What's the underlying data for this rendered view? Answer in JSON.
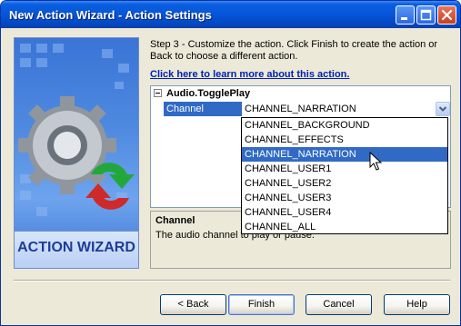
{
  "window": {
    "title": "New Action Wizard - Action Settings",
    "titlebar_color": "#0655d8",
    "controls": [
      "minimize-icon",
      "maximize-icon",
      "close-icon"
    ]
  },
  "side_panel": {
    "banner_text": "ACTION WIZARD",
    "icon": "gear-with-arrows-icon"
  },
  "instructions": {
    "step_text": "Step 3 - Customize the action.  Click Finish to create the action or Back to choose a different action.",
    "help_link": "Click here to learn more about this action."
  },
  "property_grid": {
    "group_label": "Audio.TogglePlay",
    "property_name": "Channel",
    "property_value": "CHANNEL_NARRATION",
    "selection_color": "#316ac5"
  },
  "dropdown": {
    "options": [
      "CHANNEL_BACKGROUND",
      "CHANNEL_EFFECTS",
      "CHANNEL_NARRATION",
      "CHANNEL_USER1",
      "CHANNEL_USER2",
      "CHANNEL_USER3",
      "CHANNEL_USER4",
      "CHANNEL_ALL"
    ],
    "selected": "CHANNEL_NARRATION"
  },
  "description": {
    "title": "Channel",
    "text": "The audio channel to play or pause."
  },
  "buttons": {
    "back": "< Back",
    "finish": "Finish",
    "cancel": "Cancel",
    "help": "Help"
  }
}
